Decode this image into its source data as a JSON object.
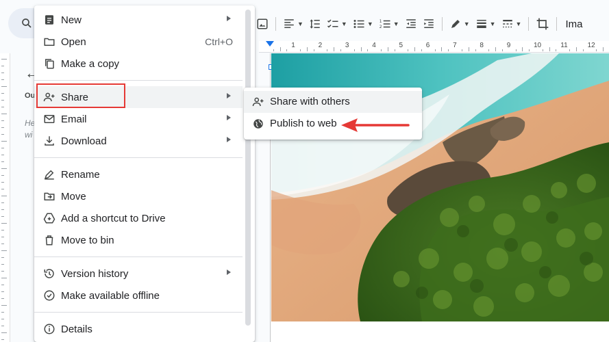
{
  "toolbar": {
    "image_options_label": "Ima",
    "icons": [
      "search-icon",
      "image-icon",
      "align-icon",
      "line-spacing-icon",
      "checklist-icon",
      "bulleted-list-icon",
      "numbered-list-icon",
      "decrease-indent-icon",
      "increase-indent-icon",
      "pen-icon",
      "border-weight-icon",
      "border-dash-icon",
      "crop-icon"
    ]
  },
  "ruler": {
    "numbers": [
      "1",
      "2",
      "3",
      "4",
      "5",
      "6",
      "7",
      "8",
      "9",
      "10",
      "11",
      "12"
    ]
  },
  "outline": {
    "heading_abbrev": "Ou",
    "hint_line1": "He",
    "hint_line2": "wi"
  },
  "file_menu": {
    "items": [
      {
        "label": "New",
        "icon": "new-doc-icon",
        "submenu": true
      },
      {
        "label": "Open",
        "icon": "folder-icon",
        "shortcut": "Ctrl+O"
      },
      {
        "label": "Make a copy",
        "icon": "copy-icon"
      },
      {
        "label": "Share",
        "icon": "share-person-icon",
        "submenu": true
      },
      {
        "label": "Email",
        "icon": "email-icon",
        "submenu": true
      },
      {
        "label": "Download",
        "icon": "download-icon",
        "submenu": true
      },
      {
        "label": "Rename",
        "icon": "rename-icon"
      },
      {
        "label": "Move",
        "icon": "move-icon"
      },
      {
        "label": "Add a shortcut to Drive",
        "icon": "drive-shortcut-icon"
      },
      {
        "label": "Move to bin",
        "icon": "bin-icon"
      },
      {
        "label": "Version history",
        "icon": "history-icon",
        "submenu": true
      },
      {
        "label": "Make available offline",
        "icon": "offline-icon"
      },
      {
        "label": "Details",
        "icon": "info-icon"
      }
    ]
  },
  "share_submenu": {
    "items": [
      {
        "label": "Share with others",
        "icon": "add-person-icon"
      },
      {
        "label": "Publish to web",
        "icon": "globe-icon"
      }
    ]
  },
  "colors": {
    "highlight_border": "#e53935",
    "annotation_arrow": "#e53935",
    "accent": "#1a73e8"
  }
}
